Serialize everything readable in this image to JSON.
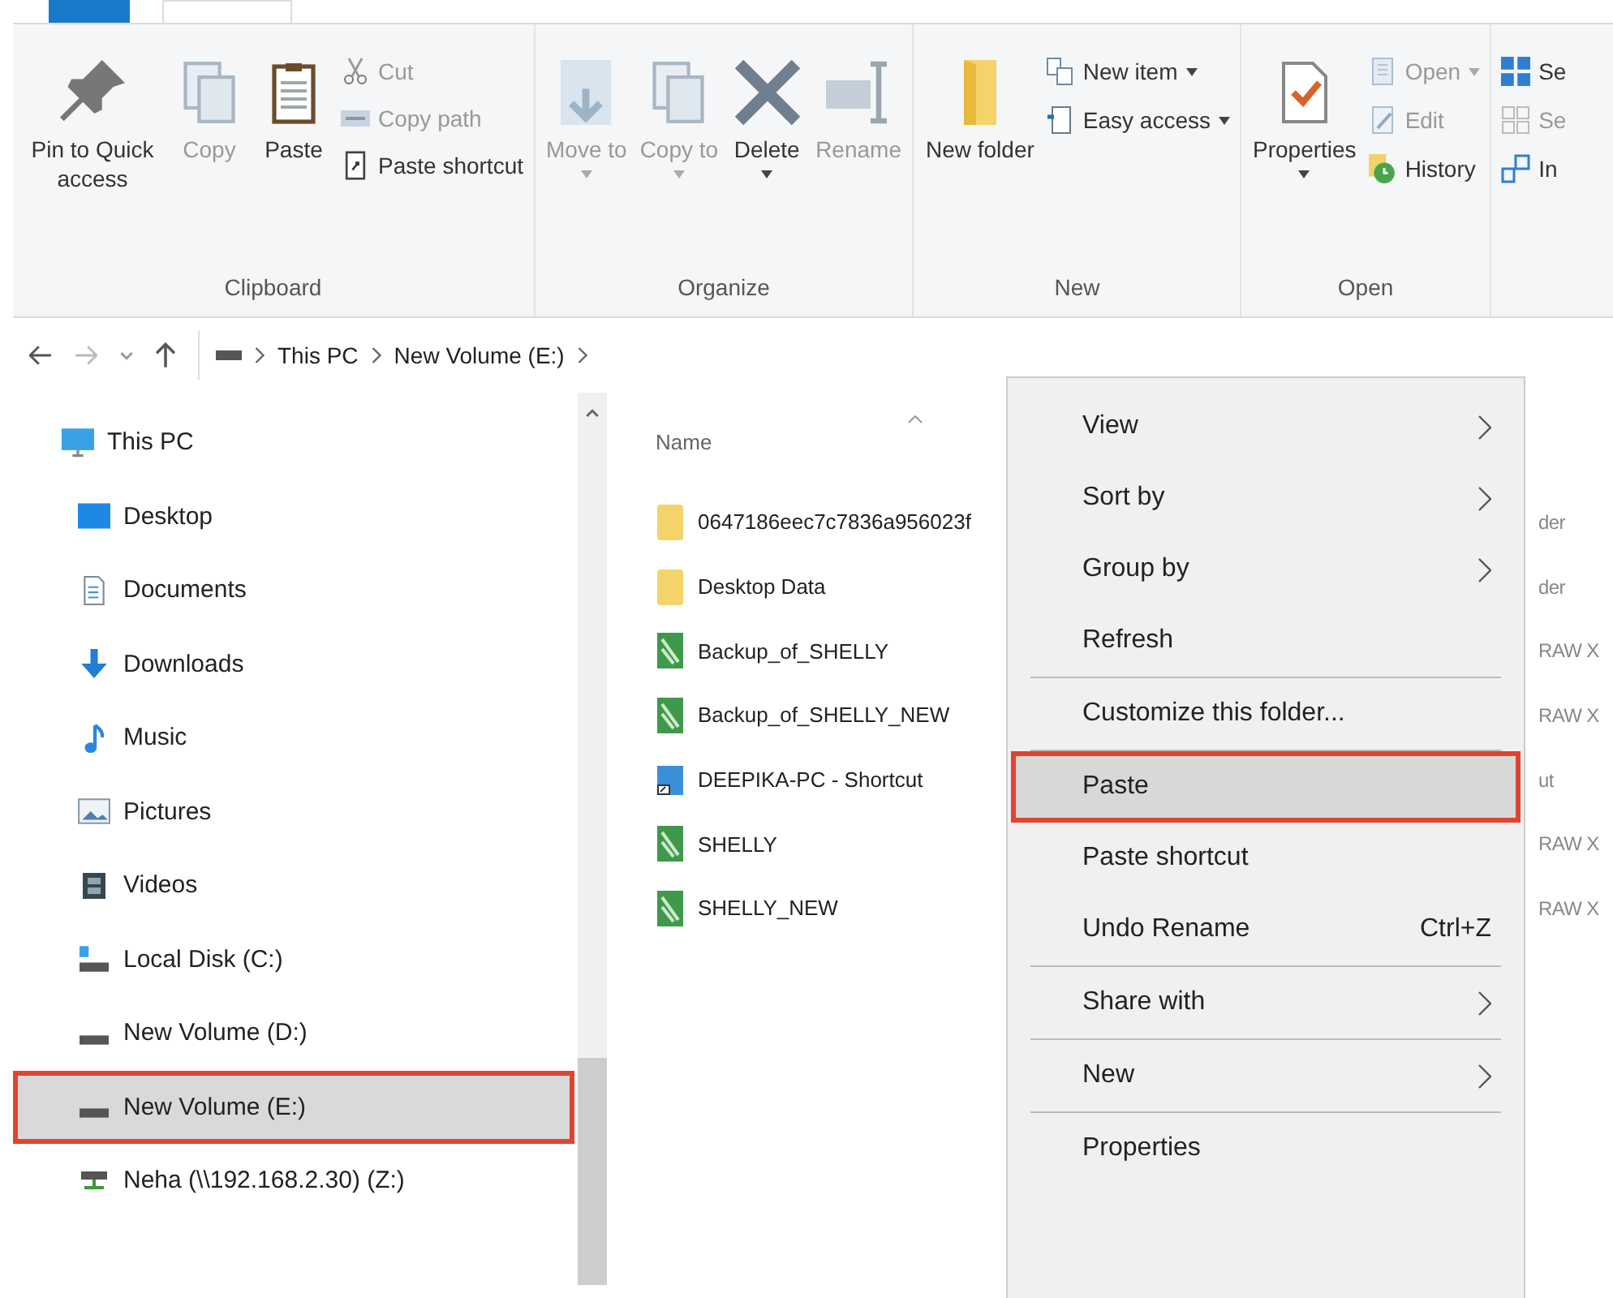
{
  "ribbon": {
    "groups": [
      {
        "label": "Clipboard",
        "large": [
          {
            "label": "Pin to Quick access",
            "disabled": false,
            "dropdown": false
          },
          {
            "label": "Copy",
            "disabled": true,
            "dropdown": false
          },
          {
            "label": "Paste",
            "disabled": false,
            "dropdown": false
          }
        ],
        "small": [
          {
            "label": "Cut",
            "disabled": true,
            "dropdown": false
          },
          {
            "label": "Copy path",
            "disabled": true,
            "dropdown": false
          },
          {
            "label": "Paste shortcut",
            "disabled": false,
            "dropdown": false
          }
        ]
      },
      {
        "label": "Organize",
        "large": [
          {
            "label": "Move to",
            "disabled": true,
            "dropdown": true
          },
          {
            "label": "Copy to",
            "disabled": true,
            "dropdown": true
          },
          {
            "label": "Delete",
            "disabled": false,
            "dropdown": true
          },
          {
            "label": "Rename",
            "disabled": true,
            "dropdown": false
          }
        ]
      },
      {
        "label": "New",
        "large": [
          {
            "label": "New folder",
            "disabled": false,
            "dropdown": false
          }
        ],
        "small": [
          {
            "label": "New item",
            "disabled": false,
            "dropdown": true
          },
          {
            "label": "Easy access",
            "disabled": false,
            "dropdown": true
          }
        ]
      },
      {
        "label": "Open",
        "large": [
          {
            "label": "Properties",
            "disabled": false,
            "dropdown": true
          }
        ],
        "small": [
          {
            "label": "Open",
            "disabled": true,
            "dropdown": true
          },
          {
            "label": "Edit",
            "disabled": true,
            "dropdown": false
          },
          {
            "label": "History",
            "disabled": false,
            "dropdown": false
          }
        ]
      },
      {
        "small": [
          {
            "label": "Se",
            "disabled": false,
            "dropdown": false
          },
          {
            "label": "Se",
            "disabled": true,
            "dropdown": false
          },
          {
            "label": "In",
            "disabled": false,
            "dropdown": false
          }
        ]
      }
    ]
  },
  "address": {
    "crumbs": [
      "This PC",
      "New Volume (E:)"
    ]
  },
  "nav": {
    "items": [
      {
        "label": "This PC",
        "selected": false,
        "children": [
          {
            "label": "Desktop",
            "selected": false
          },
          {
            "label": "Documents",
            "selected": false
          },
          {
            "label": "Downloads",
            "selected": false
          },
          {
            "label": "Music",
            "selected": false
          },
          {
            "label": "Pictures",
            "selected": false
          },
          {
            "label": "Videos",
            "selected": false
          },
          {
            "label": "Local Disk (C:)",
            "selected": false
          },
          {
            "label": "New Volume (D:)",
            "selected": false
          },
          {
            "label": "New Volume (E:)",
            "selected": true
          },
          {
            "label": "Neha (\\\\192.168.2.30) (Z:)",
            "selected": false
          }
        ]
      }
    ]
  },
  "files": {
    "columns": [
      "Name"
    ],
    "rows": [
      {
        "name": "0647186eec7c7836a956023f",
        "kind": "folder",
        "column_2": "der"
      },
      {
        "name": "Desktop Data",
        "kind": "folder",
        "column_2": "der"
      },
      {
        "name": "Backup_of_SHELLY",
        "kind": "image",
        "column_2": "RAW X"
      },
      {
        "name": "Backup_of_SHELLY_NEW",
        "kind": "image",
        "column_2": "RAW X"
      },
      {
        "name": "DEEPIKA-PC - Shortcut",
        "kind": "shortcut",
        "column_2": "ut"
      },
      {
        "name": "SHELLY",
        "kind": "image",
        "column_2": "RAW X"
      },
      {
        "name": "SHELLY_NEW",
        "kind": "image",
        "column_2": "RAW X"
      }
    ]
  },
  "context_menu": {
    "items": [
      {
        "label": "View",
        "submenu": true,
        "selected": false,
        "separator_after": false
      },
      {
        "label": "Sort by",
        "submenu": true,
        "selected": false,
        "separator_after": false
      },
      {
        "label": "Group by",
        "submenu": true,
        "selected": false,
        "separator_after": false
      },
      {
        "label": "Refresh",
        "submenu": false,
        "selected": false,
        "separator_after": true
      },
      {
        "label": "Customize this folder...",
        "submenu": false,
        "selected": false,
        "separator_after": true
      },
      {
        "label": "Paste",
        "submenu": false,
        "selected": true,
        "separator_after": false
      },
      {
        "label": "Paste shortcut",
        "submenu": false,
        "selected": false,
        "separator_after": false
      },
      {
        "label": "Undo Rename",
        "shortcut": "Ctrl+Z",
        "submenu": false,
        "selected": false,
        "separator_after": true
      },
      {
        "label": "Share with",
        "submenu": true,
        "selected": false,
        "separator_after": true
      },
      {
        "label": "New",
        "submenu": true,
        "selected": false,
        "separator_after": true
      },
      {
        "label": "Properties",
        "submenu": false,
        "selected": false,
        "separator_after": false
      }
    ]
  }
}
